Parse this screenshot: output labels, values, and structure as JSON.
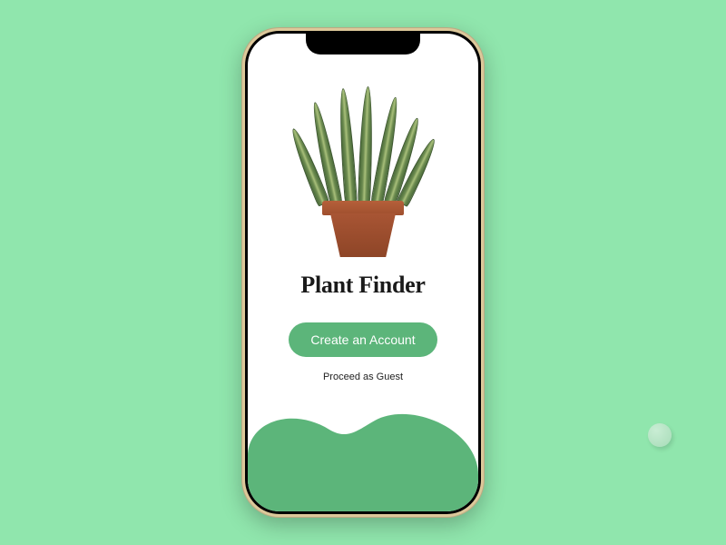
{
  "app": {
    "title": "Plant Finder"
  },
  "buttons": {
    "create_account_label": "Create an Account",
    "proceed_guest_label": "Proceed as Guest"
  },
  "colors": {
    "background": "#90e6ad",
    "primary_button": "#5cb57a",
    "wave": "#5cb57a"
  },
  "icons": {
    "hero_image": "potted-snake-plant"
  }
}
